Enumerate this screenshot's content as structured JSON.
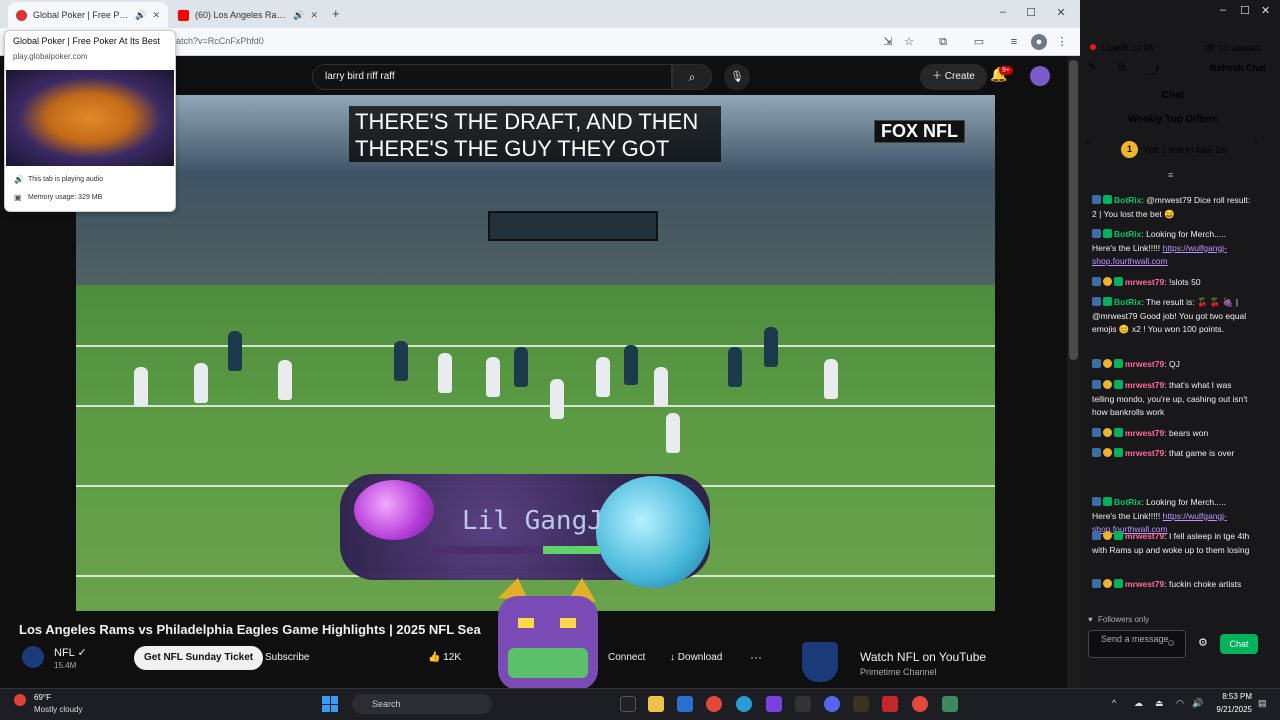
{
  "browser": {
    "tabs": [
      {
        "label": "Global Poker | Free Poker At Its Best",
        "favicon_color": "#d33"
      },
      {
        "label": "(60) Los Angeles Rams vs Philadelphia Eagles",
        "favicon_color": "#ff0000"
      }
    ],
    "url": "atch?v=RcCnFxPhfd0"
  },
  "tab_preview": {
    "title": "Global Poker | Free Poker At Its Best",
    "url": "play.globalpoker.com",
    "audio_status": "This tab is playing audio",
    "memory": "Memory usage: 329 MB"
  },
  "youtube": {
    "search_query": "larry bird riff raff",
    "create_label": "Create",
    "notif_count": "9+",
    "caption_line1": "THERE'S THE DRAFT, AND THEN",
    "caption_line2": "THERE'S THE GUY THEY GOT",
    "broadcaster_logo": "FOX NFL",
    "overlay_name": "Lil GangJ",
    "overlay_progress": 0.34,
    "video_title": "Los Angeles Rams vs Philadelphia Eagles Game Highlights | 2025 NFL Seaso",
    "channel_name": "NFL",
    "channel_subs": "15.4M",
    "sunday_ticket_label": "Get NFL Sunday Ticket",
    "subscribe_label": "Subscribe",
    "likes": "12K",
    "connect_label": "Connect",
    "download_label": "Download",
    "ad_title": "Watch NFL on YouTube",
    "ad_subtitle": "Primetime Channel"
  },
  "chat": {
    "live_label": "Live",
    "live_time": "05:14:06",
    "viewers": "13 viewers",
    "refresh_label": "Refresh Chat",
    "header": "Chat",
    "gifters_header": "Weekly Top Gifters",
    "gift_cta": "Gift 1 sub to take 1st",
    "gift_rank": "1",
    "messages": [
      {
        "user": "BotRix",
        "text": "@mrwest79 Dice roll result: 2 | You lost the bet 😄",
        "user_color": "#00c46a"
      },
      {
        "user": "BotRix",
        "text": "Looking for Merch..... Here's the Link!!!!! ",
        "link": "https://wulfgangj-shop.fourthwall.com",
        "user_color": "#00c46a"
      },
      {
        "user": "mrwest79",
        "text": "!slots 50",
        "user_color": "#ff6b9d"
      },
      {
        "user": "BotRix",
        "text": "The result is: 🍒 🍒 🍇 | @mrwest79 Good job! You got two equal emojis 😊 x2 ! You won 100 points.",
        "user_color": "#00c46a"
      },
      {
        "user": "mrwest79",
        "text": "QJ",
        "user_color": "#ff6b9d"
      },
      {
        "user": "mrwest79",
        "text": "that's what I was telling mondo, you're up, cashing out isn't how bankrolls work",
        "user_color": "#ff6b9d"
      },
      {
        "user": "mrwest79",
        "text": "bears won",
        "user_color": "#ff6b9d"
      },
      {
        "user": "mrwest79",
        "text": "that game is over",
        "user_color": "#ff6b9d"
      },
      {
        "user": "BotRix",
        "text": "Looking for Merch..... Here's the Link!!!!! ",
        "link": "https://wulfgangj-shop.fourthwall.com",
        "user_color": "#00c46a"
      },
      {
        "user": "mrwest79",
        "text": "I fell asleep in tge 4th with Rams up and woke up to them losing",
        "user_color": "#ff6b9d"
      },
      {
        "user": "mrwest79",
        "text": "fuckin choke artists",
        "user_color": "#ff6b9d"
      }
    ],
    "followers_only": "Followers only",
    "input_placeholder": "Send a message",
    "send_label": "Chat"
  },
  "taskbar": {
    "weather_temp": "69°F",
    "weather_cond": "Mostly cloudy",
    "search_label": "Search",
    "time": "8:53 PM",
    "date": "9/21/2025"
  },
  "colors": {
    "accent_red": "#ff0000",
    "chat_green": "#00b35a",
    "link_purple": "#bf94ff"
  }
}
